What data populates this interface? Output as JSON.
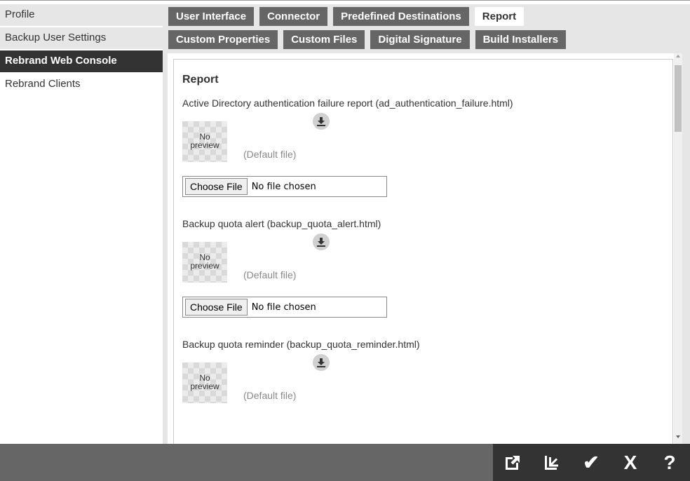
{
  "sidebar": {
    "items": [
      {
        "label": "Profile"
      },
      {
        "label": "Backup User Settings"
      },
      {
        "label": "Rebrand Web Console"
      },
      {
        "label": "Rebrand Clients"
      }
    ]
  },
  "tabs": {
    "row1": [
      "User Interface",
      "Connector",
      "Predefined Destinations",
      "Report"
    ],
    "row2": [
      "Custom Properties",
      "Custom Files",
      "Digital Signature",
      "Build Installers"
    ],
    "active": "Report"
  },
  "content": {
    "title": "Report",
    "items": [
      {
        "label": "Active Directory authentication failure report  (ad_authentication_failure.html)",
        "preview": "No preview",
        "default_file": "(Default file)",
        "choose_file": "Choose File",
        "file_status": "No file chosen"
      },
      {
        "label": "Backup quota alert  (backup_quota_alert.html)",
        "preview": "No preview",
        "default_file": "(Default file)",
        "choose_file": "Choose File",
        "file_status": "No file chosen"
      },
      {
        "label": "Backup quota reminder  (backup_quota_reminder.html)",
        "preview": "No preview",
        "default_file": "(Default file)"
      }
    ]
  },
  "footer": {
    "buttons": [
      {
        "icon": "export-icon"
      },
      {
        "icon": "import-icon"
      },
      {
        "icon": "save-check-icon",
        "glyph": "✔"
      },
      {
        "icon": "cancel-x-icon",
        "glyph": "X"
      },
      {
        "icon": "help-icon",
        "glyph": "?"
      }
    ]
  },
  "colors": {
    "active_nav": "#333333",
    "tab_bg": "#666666",
    "panel_bg": "#e6e6e6",
    "footer_bg": "#666666",
    "footer_actions_bg": "#333333"
  }
}
